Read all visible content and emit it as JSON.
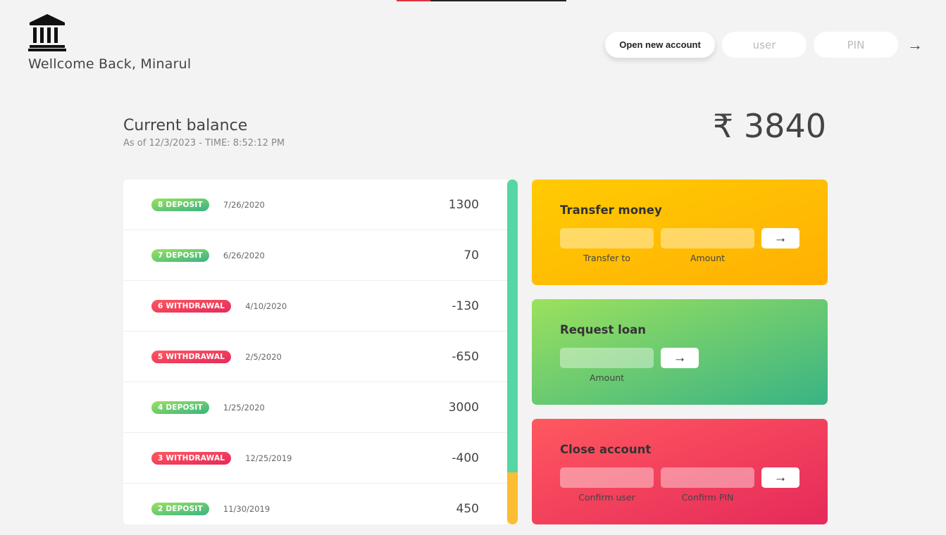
{
  "header": {
    "welcome": "Wellcome Back, Minarul",
    "logo_icon": "bank-icon",
    "open_account_label": "Open new account",
    "user_placeholder": "user",
    "pin_placeholder": "PIN",
    "login_arrow": "→"
  },
  "balance": {
    "label": "Current balance",
    "date_text": "As of 12/3/2023 - TIME: 8:52:12 PM",
    "value": "₹ 3840"
  },
  "movements": [
    {
      "type_label": "8 DEPOSIT",
      "kind": "deposit",
      "date": "7/26/2020",
      "value": "1300"
    },
    {
      "type_label": "7 DEPOSIT",
      "kind": "deposit",
      "date": "6/26/2020",
      "value": "70"
    },
    {
      "type_label": "6 WITHDRAWAL",
      "kind": "withdrawal",
      "date": "4/10/2020",
      "value": "-130"
    },
    {
      "type_label": "5 WITHDRAWAL",
      "kind": "withdrawal",
      "date": "2/5/2020",
      "value": "-650"
    },
    {
      "type_label": "4 DEPOSIT",
      "kind": "deposit",
      "date": "1/25/2020",
      "value": "3000"
    },
    {
      "type_label": "3 WITHDRAWAL",
      "kind": "withdrawal",
      "date": "12/25/2019",
      "value": "-400"
    },
    {
      "type_label": "2 DEPOSIT",
      "kind": "deposit",
      "date": "11/30/2019",
      "value": "450"
    }
  ],
  "operations": {
    "transfer": {
      "title": "Transfer money",
      "label_to": "Transfer to",
      "label_amount": "Amount",
      "button": "→"
    },
    "loan": {
      "title": "Request loan",
      "label_amount": "Amount",
      "button": "→"
    },
    "close": {
      "title": "Close account",
      "label_user": "Confirm user",
      "label_pin": "Confirm PIN",
      "button": "→"
    }
  },
  "colors": {
    "deposit": "#39b385",
    "withdrawal": "#e52a5a",
    "transfer_bg": "#ffb003",
    "loan_bg": "#9be15d",
    "close_bg": "#ff585f",
    "scroll_thumb": "#55d6a4",
    "scroll_track": "#fbbd32"
  }
}
